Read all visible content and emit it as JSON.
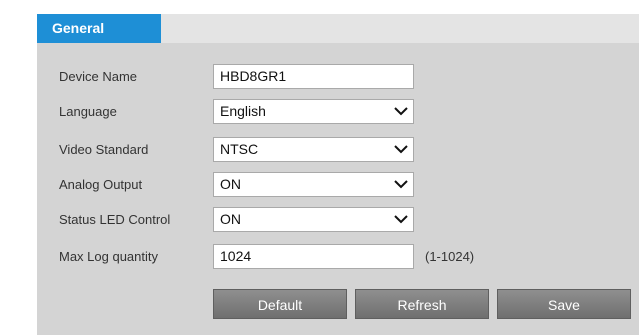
{
  "tab": {
    "label": "General"
  },
  "fields": {
    "device_name": {
      "label": "Device Name",
      "value": "HBD8GR1"
    },
    "language": {
      "label": "Language",
      "value": "English"
    },
    "video_standard": {
      "label": "Video Standard",
      "value": "NTSC"
    },
    "analog_output": {
      "label": "Analog Output",
      "value": "ON"
    },
    "status_led": {
      "label": "Status LED Control",
      "value": "ON"
    },
    "max_log": {
      "label": "Max Log quantity",
      "value": "1024",
      "hint": "(1-1024)"
    }
  },
  "buttons": {
    "default": "Default",
    "refresh": "Refresh",
    "save": "Save"
  },
  "colors": {
    "tab_active": "#1e8fd6",
    "panel_bg": "#d4d4d4",
    "button_bg": "#7d7d7d"
  }
}
